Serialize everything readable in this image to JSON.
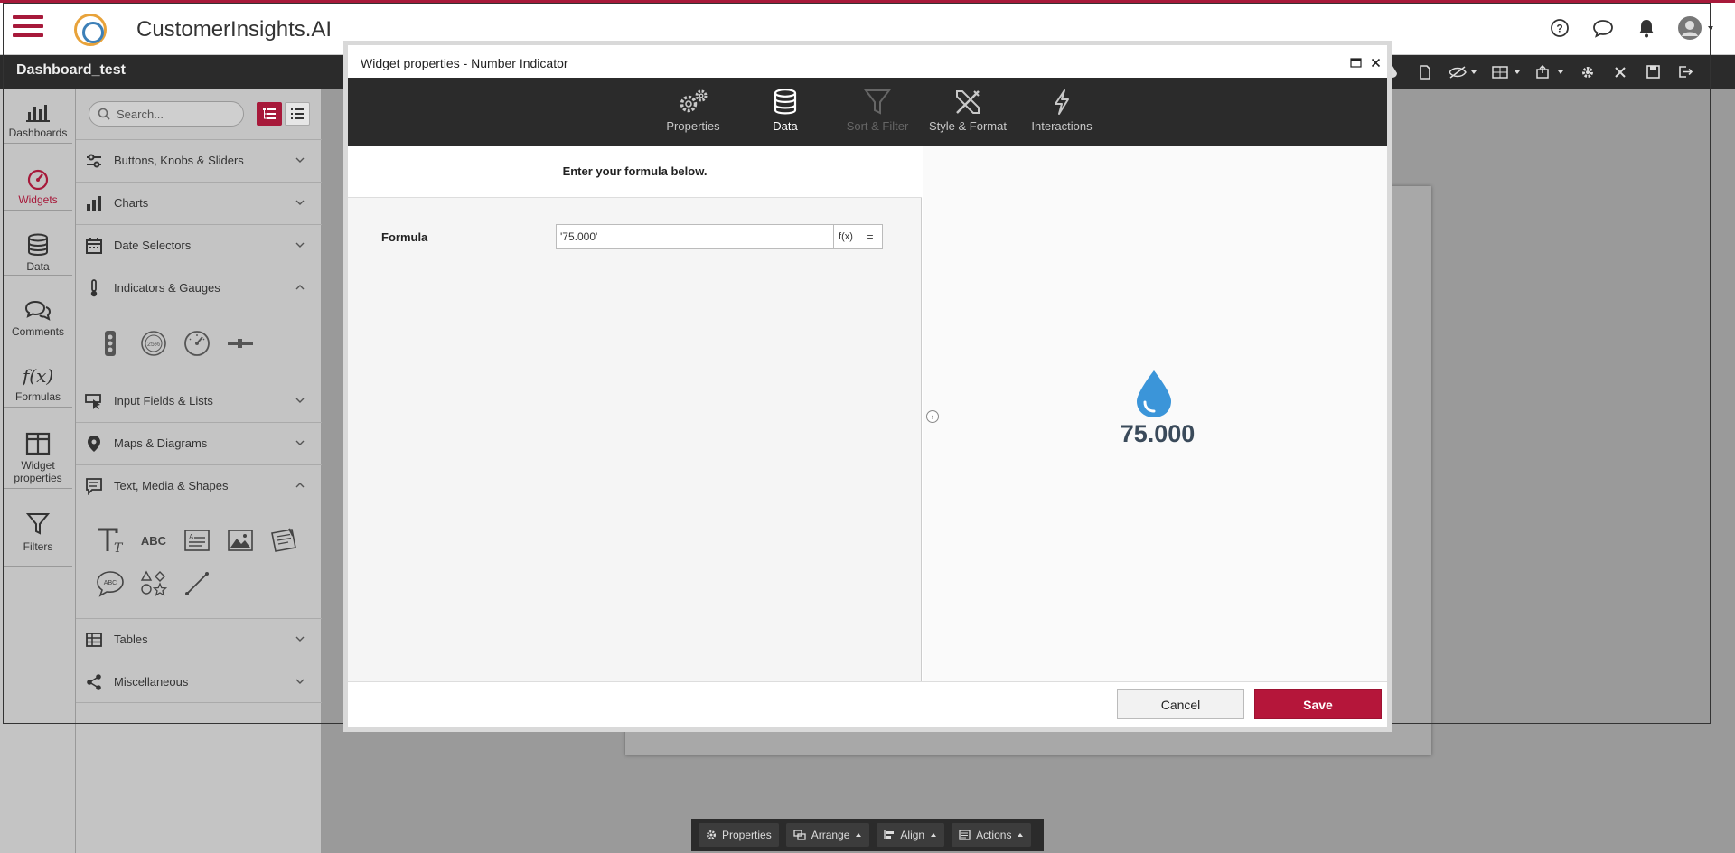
{
  "app": {
    "title": "CustomerInsights.AI",
    "dashboard_title": "Dashboard_test"
  },
  "colors": {
    "accent": "#a7193a",
    "save": "#b5163a",
    "drop": "#3b95d9"
  },
  "leftnav": [
    {
      "label": "Dashboards",
      "icon": "bar-chart-icon"
    },
    {
      "label": "Widgets",
      "icon": "gauge-icon",
      "active": true
    },
    {
      "label": "Data",
      "icon": "database-icon"
    },
    {
      "label": "Comments",
      "icon": "comments-icon"
    },
    {
      "label": "Formulas",
      "icon": "function-icon"
    },
    {
      "label": "Widget properties",
      "icon": "layout-icon"
    },
    {
      "label": "Filters",
      "icon": "filter-icon"
    }
  ],
  "panel": {
    "search_placeholder": "Search...",
    "categories": [
      {
        "label": "Buttons, Knobs & Sliders",
        "expanded": false
      },
      {
        "label": "Charts",
        "expanded": false
      },
      {
        "label": "Date Selectors",
        "expanded": false
      },
      {
        "label": "Indicators & Gauges",
        "expanded": true
      },
      {
        "label": "Input Fields & Lists",
        "expanded": false
      },
      {
        "label": "Maps & Diagrams",
        "expanded": false
      },
      {
        "label": "Text, Media & Shapes",
        "expanded": true
      },
      {
        "label": "Tables",
        "expanded": false
      },
      {
        "label": "Miscellaneous",
        "expanded": false
      }
    ],
    "gauge_widget_percent": "25%",
    "text_widget_abc": "ABC",
    "shape_widget_abc": "ABC"
  },
  "modal": {
    "title": "Widget properties - Number Indicator",
    "tabs": [
      {
        "label": "Properties",
        "state": "normal"
      },
      {
        "label": "Data",
        "state": "active"
      },
      {
        "label": "Sort & Filter",
        "state": "disabled"
      },
      {
        "label": "Style & Format",
        "state": "normal"
      },
      {
        "label": "Interactions",
        "state": "normal"
      }
    ],
    "instruction": "Enter your formula below.",
    "formula_label": "Formula",
    "formula_value": "'75.000'",
    "fx_label": "f(x)",
    "equals_label": "=",
    "indicator_value": "75.000",
    "cancel_label": "Cancel",
    "save_label": "Save"
  },
  "bottombar": [
    {
      "label": "Properties",
      "icon": "gear-icon"
    },
    {
      "label": "Arrange",
      "icon": "arrange-icon"
    },
    {
      "label": "Align",
      "icon": "align-icon"
    },
    {
      "label": "Actions",
      "icon": "actions-icon"
    }
  ]
}
